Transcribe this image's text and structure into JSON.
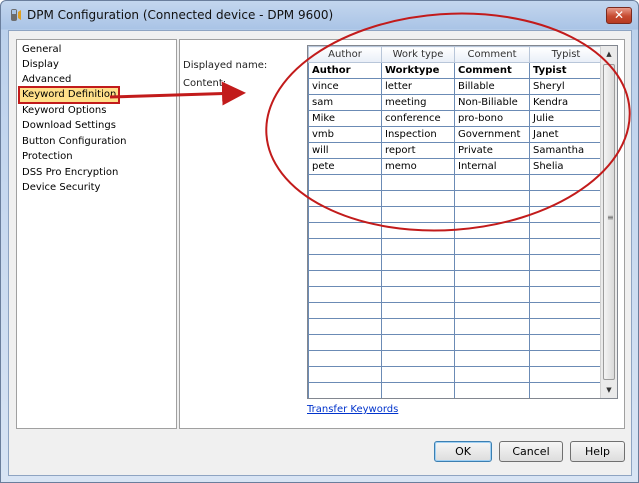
{
  "window": {
    "title": "DPM Configuration (Connected device - DPM 9600)",
    "close_glyph": "✕"
  },
  "nav": {
    "items": [
      {
        "label": "General"
      },
      {
        "label": "Display"
      },
      {
        "label": "Advanced"
      },
      {
        "label": "Keyword Definition",
        "selected": true
      },
      {
        "label": "Keyword Options"
      },
      {
        "label": "Download Settings"
      },
      {
        "label": "Button Configuration"
      },
      {
        "label": "Protection"
      },
      {
        "label": "DSS Pro Encryption"
      },
      {
        "label": "Device Security"
      }
    ]
  },
  "panel": {
    "displayed_name_label": "Displayed name:",
    "content_label": "Content:",
    "grid": {
      "columns": [
        "Author",
        "Work type",
        "Comment",
        "Typist"
      ],
      "rows": [
        [
          "Author",
          "Worktype",
          "Comment",
          "Typist"
        ],
        [
          "vince",
          "letter",
          "Billable",
          "Sheryl"
        ],
        [
          "sam",
          "meeting",
          "Non-Biliable",
          "Kendra"
        ],
        [
          "Mike",
          "conference",
          "pro-bono",
          "Julie"
        ],
        [
          "vmb",
          "Inspection",
          "Government",
          "Janet"
        ],
        [
          "will",
          "report",
          "Private",
          "Samantha"
        ],
        [
          "pete",
          "memo",
          "Internal",
          "Shelia"
        ],
        [
          "",
          "",
          "",
          ""
        ],
        [
          "",
          "",
          "",
          ""
        ],
        [
          "",
          "",
          "",
          ""
        ],
        [
          "",
          "",
          "",
          ""
        ],
        [
          "",
          "",
          "",
          ""
        ],
        [
          "",
          "",
          "",
          ""
        ],
        [
          "",
          "",
          "",
          ""
        ],
        [
          "",
          "",
          "",
          ""
        ],
        [
          "",
          "",
          "",
          ""
        ],
        [
          "",
          "",
          "",
          ""
        ],
        [
          "",
          "",
          "",
          ""
        ],
        [
          "",
          "",
          "",
          ""
        ],
        [
          "",
          "",
          "",
          ""
        ],
        [
          "",
          "",
          "",
          ""
        ]
      ]
    },
    "scroll_up_glyph": "▲",
    "scroll_down_glyph": "▼",
    "scroll_grip_glyph": "≡",
    "transfer_link": "Transfer Keywords"
  },
  "buttons": {
    "ok": "OK",
    "cancel": "Cancel",
    "help": "Help"
  },
  "colors": {
    "annotation_red": "#c21b1b",
    "selection_yellow": "#ffe08a",
    "link_blue": "#0033cc"
  }
}
